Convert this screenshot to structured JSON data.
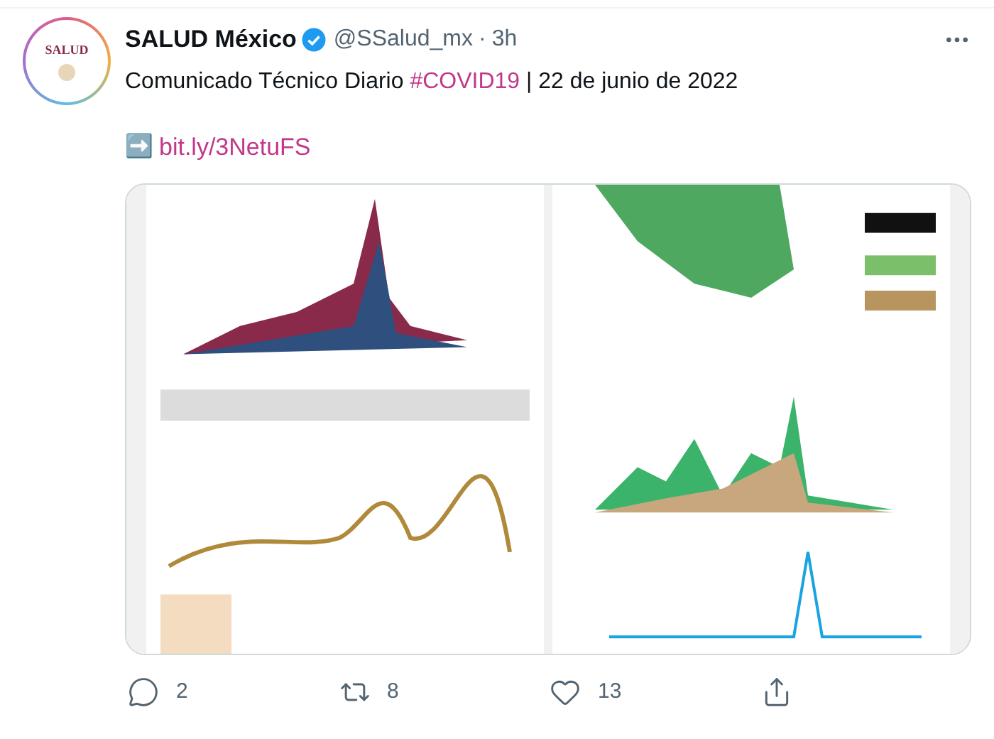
{
  "tweet": {
    "avatar_text": "SALUD",
    "name": "SALUD México",
    "verified": true,
    "handle": "@SSalud_mx",
    "separator": "·",
    "time": "3h",
    "text_parts": [
      {
        "kind": "plain",
        "text": "Comunicado Técnico Diario "
      },
      {
        "kind": "hashtag",
        "text": "#COVID19"
      },
      {
        "kind": "plain",
        "text": " | 22 de junio de 2022"
      }
    ],
    "link_emoji": "➡️",
    "link": "bit.ly/3NetuFS"
  },
  "actions": [
    {
      "kind": "reply",
      "count": "2"
    },
    {
      "kind": "retweet",
      "count": "8"
    },
    {
      "kind": "like",
      "count": "13"
    },
    {
      "kind": "share"
    }
  ]
}
